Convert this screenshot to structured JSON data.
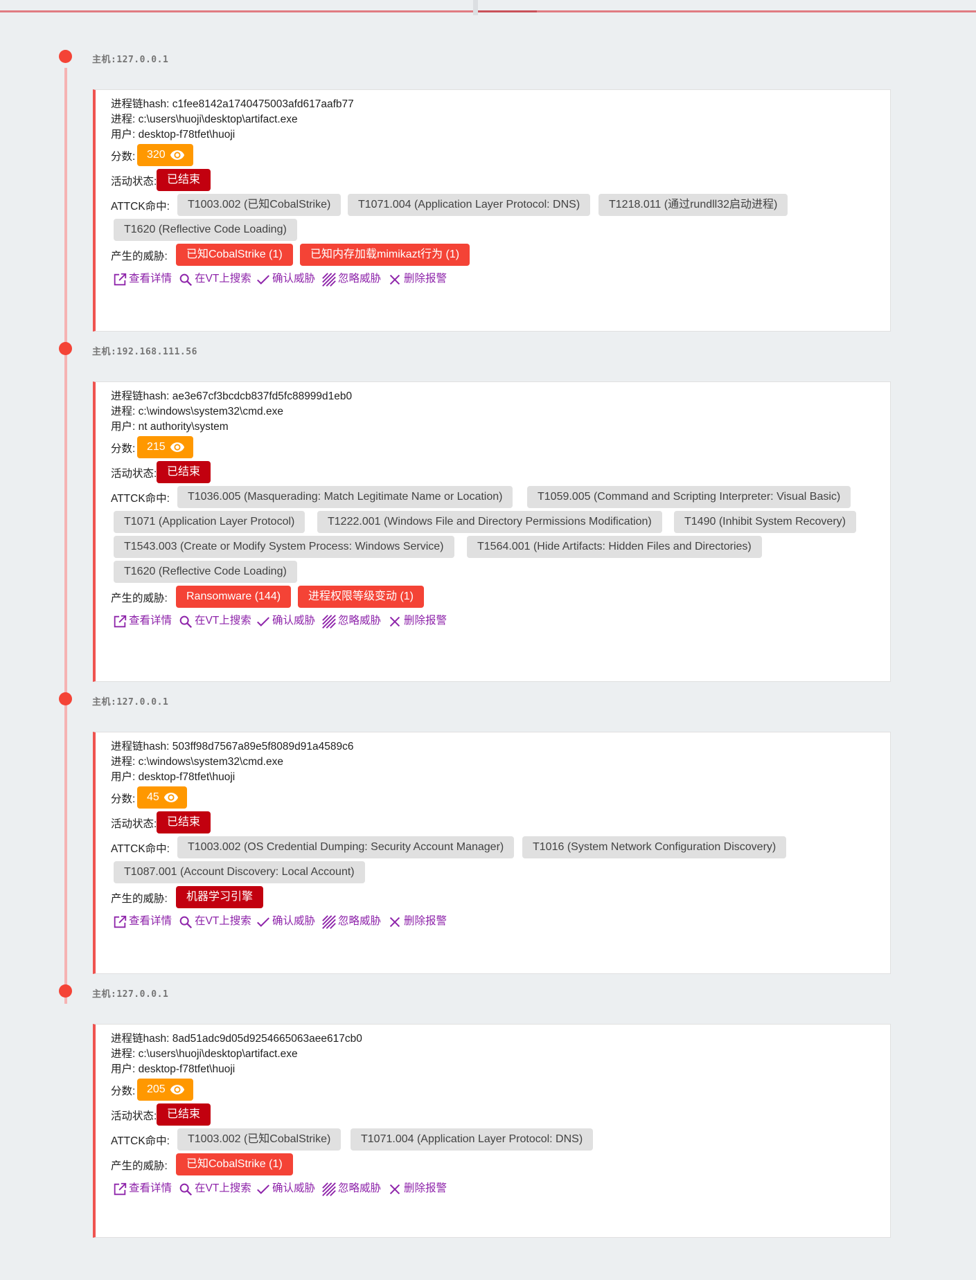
{
  "labels": {
    "score": "分数:",
    "status": "活动状态:",
    "attck": "ATTCK命中:",
    "threats": "产生的威胁:",
    "hash_prefix": "进程链hash: ",
    "process_prefix": "进程: ",
    "user_prefix": "用户: ",
    "host_prefix": "主机:"
  },
  "actions": {
    "view": "查看详情",
    "vt": "在VT上搜索",
    "confirm": "确认威胁",
    "ignore": "忽略威胁",
    "delete": "删除报警"
  },
  "colors": {
    "accent": "#f44336",
    "score": "#ff9800",
    "status": "#c2000f",
    "action": "#8e24aa",
    "chip_gray": "#e0e0e0"
  },
  "entries": [
    {
      "host": "127.0.0.1",
      "hash": "c1fee8142a1740475003afd617aafb77",
      "process": "c:\\users\\huoji\\desktop\\artifact.exe",
      "user": "desktop-f78tfet\\huoji",
      "score": "320",
      "status": "已结束",
      "attck": [
        "T1003.002 (已知CobalStrike)",
        "T1071.004 (Application Layer Protocol: DNS)",
        "T1218.011 (通过rundll32启动进程)",
        "T1620 (Reflective Code Loading)"
      ],
      "threats": [
        "已知CobalStrike (1)",
        "已知内存加载mimikazt行为 (1)"
      ]
    },
    {
      "host": "192.168.111.56",
      "hash": "ae3e67cf3bcdcb837fd5fc88999d1eb0",
      "process": "c:\\windows\\system32\\cmd.exe",
      "user": "nt authority\\system",
      "score": "215",
      "status": "已结束",
      "attck": [
        "T1036.005 (Masquerading: Match Legitimate Name or Location)",
        "T1059.005 (Command and Scripting Interpreter: Visual Basic)",
        "T1071 (Application Layer Protocol)",
        "T1222.001 (Windows File and Directory Permissions Modification)",
        "T1490 (Inhibit System Recovery)",
        "T1543.003 (Create or Modify System Process: Windows Service)",
        "T1564.001 (Hide Artifacts: Hidden Files and Directories)",
        "T1620 (Reflective Code Loading)"
      ],
      "threats": [
        "Ransomware (144)",
        "进程权限等级变动 (1)"
      ]
    },
    {
      "host": "127.0.0.1",
      "hash": "503ff98d7567a89e5f8089d91a4589c6",
      "process": "c:\\windows\\system32\\cmd.exe",
      "user": "desktop-f78tfet\\huoji",
      "score": "45",
      "status": "已结束",
      "attck": [
        "T1003.002 (OS Credential Dumping: Security Account Manager)",
        "T1016 (System Network Configuration Discovery)",
        "T1087.001 (Account Discovery: Local Account)"
      ],
      "threats": [
        "机器学习引擎"
      ]
    },
    {
      "host": "127.0.0.1",
      "hash": "8ad51adc9d05d9254665063aee617cb0",
      "process": "c:\\users\\huoji\\desktop\\artifact.exe",
      "user": "desktop-f78tfet\\huoji",
      "score": "205",
      "status": "已结束",
      "attck": [
        "T1003.002 (已知CobalStrike)",
        "T1071.004 (Application Layer Protocol: DNS)"
      ],
      "threats": [
        "已知CobalStrike (1)"
      ]
    }
  ]
}
